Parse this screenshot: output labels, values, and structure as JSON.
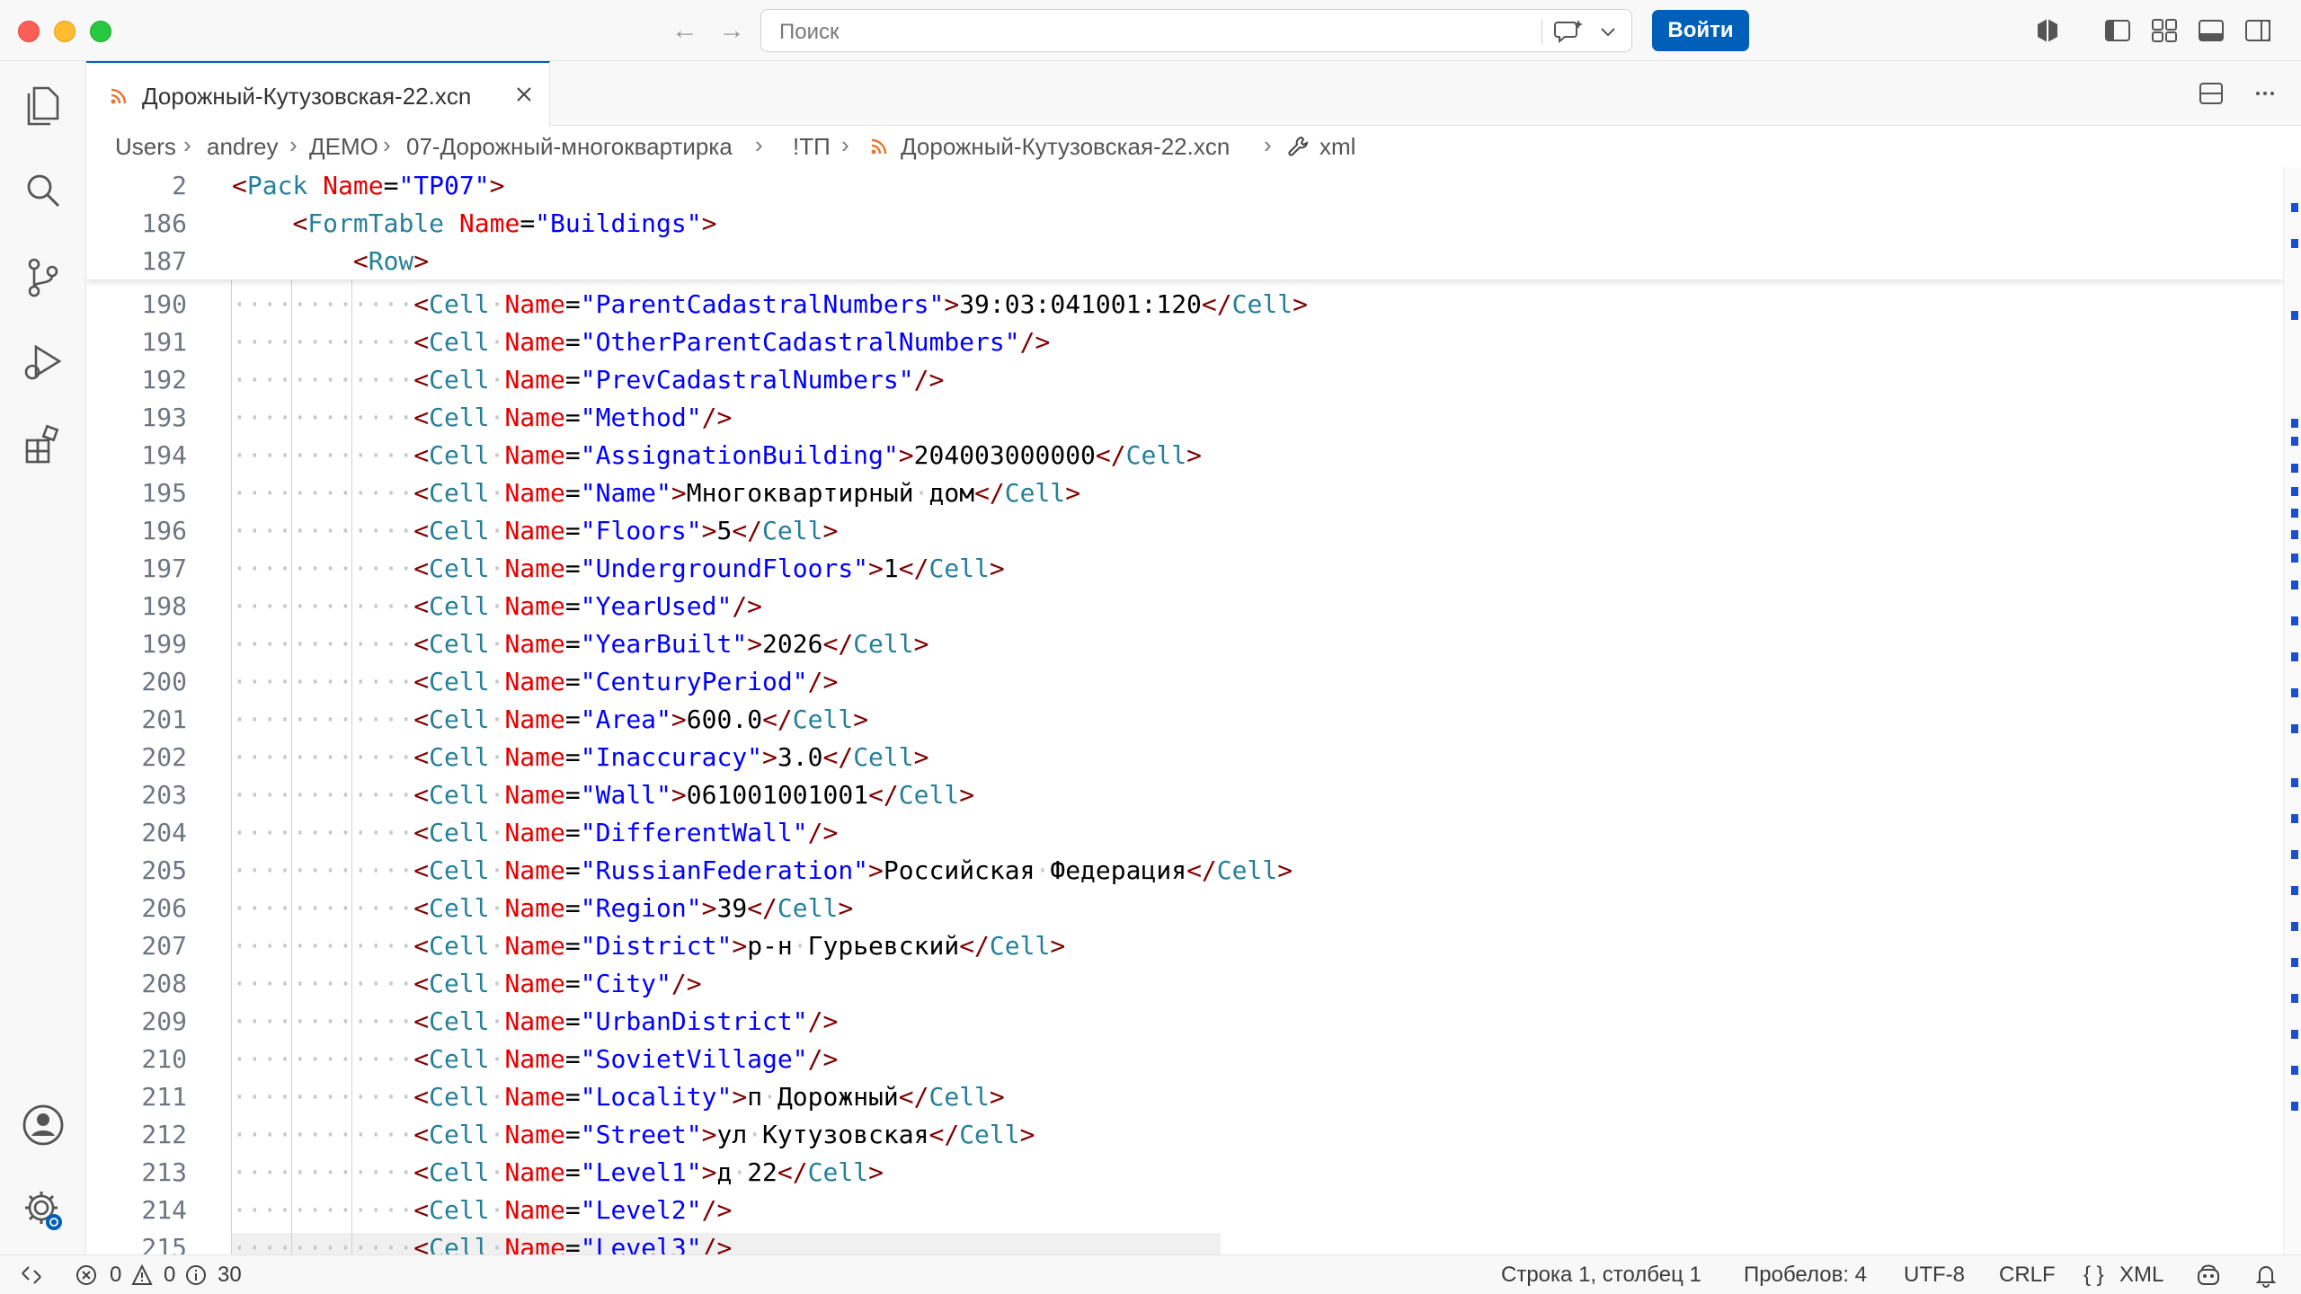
{
  "titlebar": {
    "back_arrow": "←",
    "forward_arrow": "→",
    "search_placeholder": "Поиск",
    "login_label": "Войти",
    "icons": [
      "copilot-icon",
      "toggle-primary-sidebar-icon",
      "customize-layout-icon",
      "toggle-panel-icon",
      "toggle-secondary-sidebar-icon"
    ]
  },
  "activitybar": {
    "items": [
      "explorer-icon",
      "search-icon",
      "source-control-icon",
      "run-debug-icon",
      "extensions-icon"
    ],
    "bottom": [
      "accounts-icon",
      "manage-gear-icon"
    ]
  },
  "tab": {
    "label": "Дорожный-Кутузовская-22.xcn",
    "icon": "rss-icon",
    "close": "×"
  },
  "breadcrumb": {
    "items": [
      "Users",
      "andrey",
      "ДЕМО",
      "07-Дорожный-многоквартирка",
      "!ТП",
      "Дорожный-Кутузовская-22.xcn",
      "xml"
    ],
    "separator": "›"
  },
  "editor": {
    "sticky": [
      {
        "num": "2",
        "indent": "",
        "tag": "Pack",
        "attr": "Name",
        "val": "TP07",
        "close": ">"
      },
      {
        "num": "186",
        "indent": "    ",
        "tag": "FormTable",
        "attr": "Name",
        "val": "Buildings",
        "close": ">"
      },
      {
        "num": "187",
        "indent": "        ",
        "tag": "Row",
        "attr": "",
        "val": "",
        "close": ">"
      }
    ],
    "lines": [
      {
        "num": "190",
        "name": "ParentCadastralNumbers",
        "text": "39:03:041001:120"
      },
      {
        "num": "191",
        "name": "OtherParentCadastralNumbers",
        "text": ""
      },
      {
        "num": "192",
        "name": "PrevCadastralNumbers",
        "text": ""
      },
      {
        "num": "193",
        "name": "Method",
        "text": ""
      },
      {
        "num": "194",
        "name": "AssignationBuilding",
        "text": "204003000000"
      },
      {
        "num": "195",
        "name": "Name",
        "text": "Многоквартирный дом"
      },
      {
        "num": "196",
        "name": "Floors",
        "text": "5"
      },
      {
        "num": "197",
        "name": "UndergroundFloors",
        "text": "1"
      },
      {
        "num": "198",
        "name": "YearUsed",
        "text": ""
      },
      {
        "num": "199",
        "name": "YearBuilt",
        "text": "2026"
      },
      {
        "num": "200",
        "name": "CenturyPeriod",
        "text": ""
      },
      {
        "num": "201",
        "name": "Area",
        "text": "600.0"
      },
      {
        "num": "202",
        "name": "Inaccuracy",
        "text": "3.0"
      },
      {
        "num": "203",
        "name": "Wall",
        "text": "061001001001"
      },
      {
        "num": "204",
        "name": "DifferentWall",
        "text": ""
      },
      {
        "num": "205",
        "name": "RussianFederation",
        "text": "Российская Федерация"
      },
      {
        "num": "206",
        "name": "Region",
        "text": "39"
      },
      {
        "num": "207",
        "name": "District",
        "text": "р-н Гурьевский"
      },
      {
        "num": "208",
        "name": "City",
        "text": ""
      },
      {
        "num": "209",
        "name": "UrbanDistrict",
        "text": ""
      },
      {
        "num": "210",
        "name": "SovietVillage",
        "text": ""
      },
      {
        "num": "211",
        "name": "Locality",
        "text": "п Дорожный"
      },
      {
        "num": "212",
        "name": "Street",
        "text": "ул Кутузовская"
      },
      {
        "num": "213",
        "name": "Level1",
        "text": "д 22"
      },
      {
        "num": "214",
        "name": "Level2",
        "text": ""
      },
      {
        "num": "215",
        "name": "Level3",
        "text": ""
      }
    ]
  },
  "statusbar": {
    "errors": "0",
    "warnings": "0",
    "infos": "30",
    "position": "Строка 1, столбец 1",
    "spaces": "Пробелов: 4",
    "encoding": "UTF-8",
    "eol": "CRLF",
    "language_brace": "{ }",
    "language": "XML"
  },
  "colors": {
    "accent": "#005fb8",
    "tag_bracket": "#800000",
    "tag_name": "#267f99",
    "attr_name": "#e50000",
    "attr_value": "#0000ff"
  }
}
